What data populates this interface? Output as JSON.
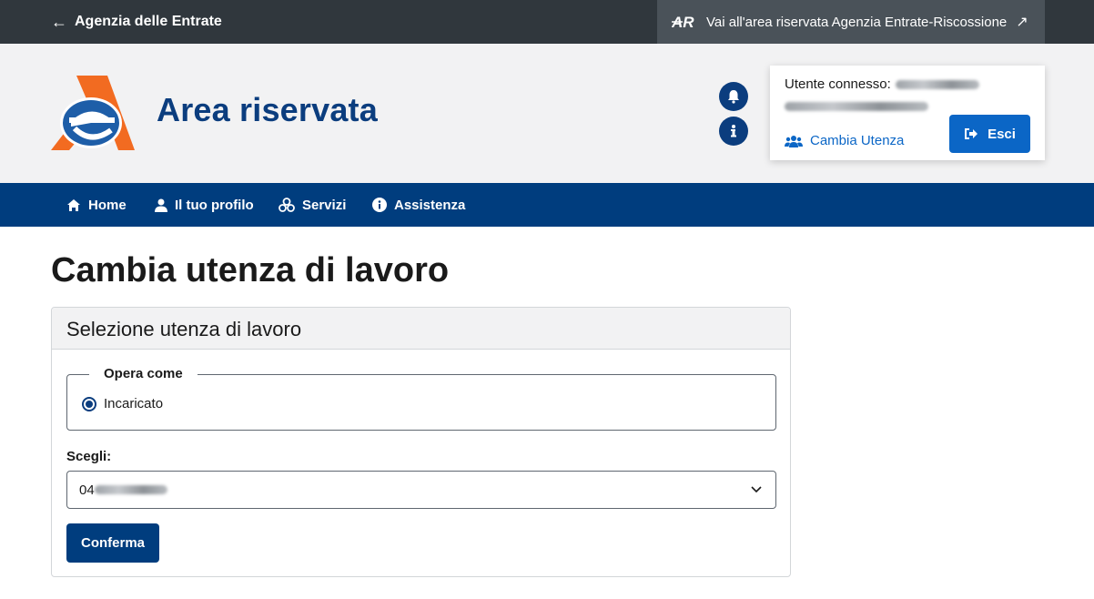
{
  "topbar": {
    "back_label": "Agenzia delle Entrate",
    "external_link_label": "Vai all'area riservata Agenzia Entrate-Riscossione"
  },
  "header": {
    "site_title": "Area riservata",
    "user_label": "Utente connesso:",
    "switch_user_label": "Cambia Utenza",
    "logout_label": "Esci"
  },
  "nav": {
    "items": [
      {
        "label": "Home",
        "icon": "home-icon"
      },
      {
        "label": "Il tuo profilo",
        "icon": "user-icon"
      },
      {
        "label": "Servizi",
        "icon": "services-icon"
      },
      {
        "label": "Assistenza",
        "icon": "info-icon"
      }
    ]
  },
  "main": {
    "page_title": "Cambia utenza di lavoro",
    "card_title": "Selezione utenza di lavoro",
    "fieldset_legend": "Opera come",
    "radio_label": "Incaricato",
    "select_label": "Scegli:",
    "select_value_prefix": "04",
    "confirm_label": "Conferma"
  },
  "colors": {
    "brand_blue": "#0b3d7e",
    "nav_blue": "#003d7e",
    "link_blue": "#0b66c6",
    "topbar_dark": "#30373d",
    "logo_orange": "#f26b21"
  }
}
